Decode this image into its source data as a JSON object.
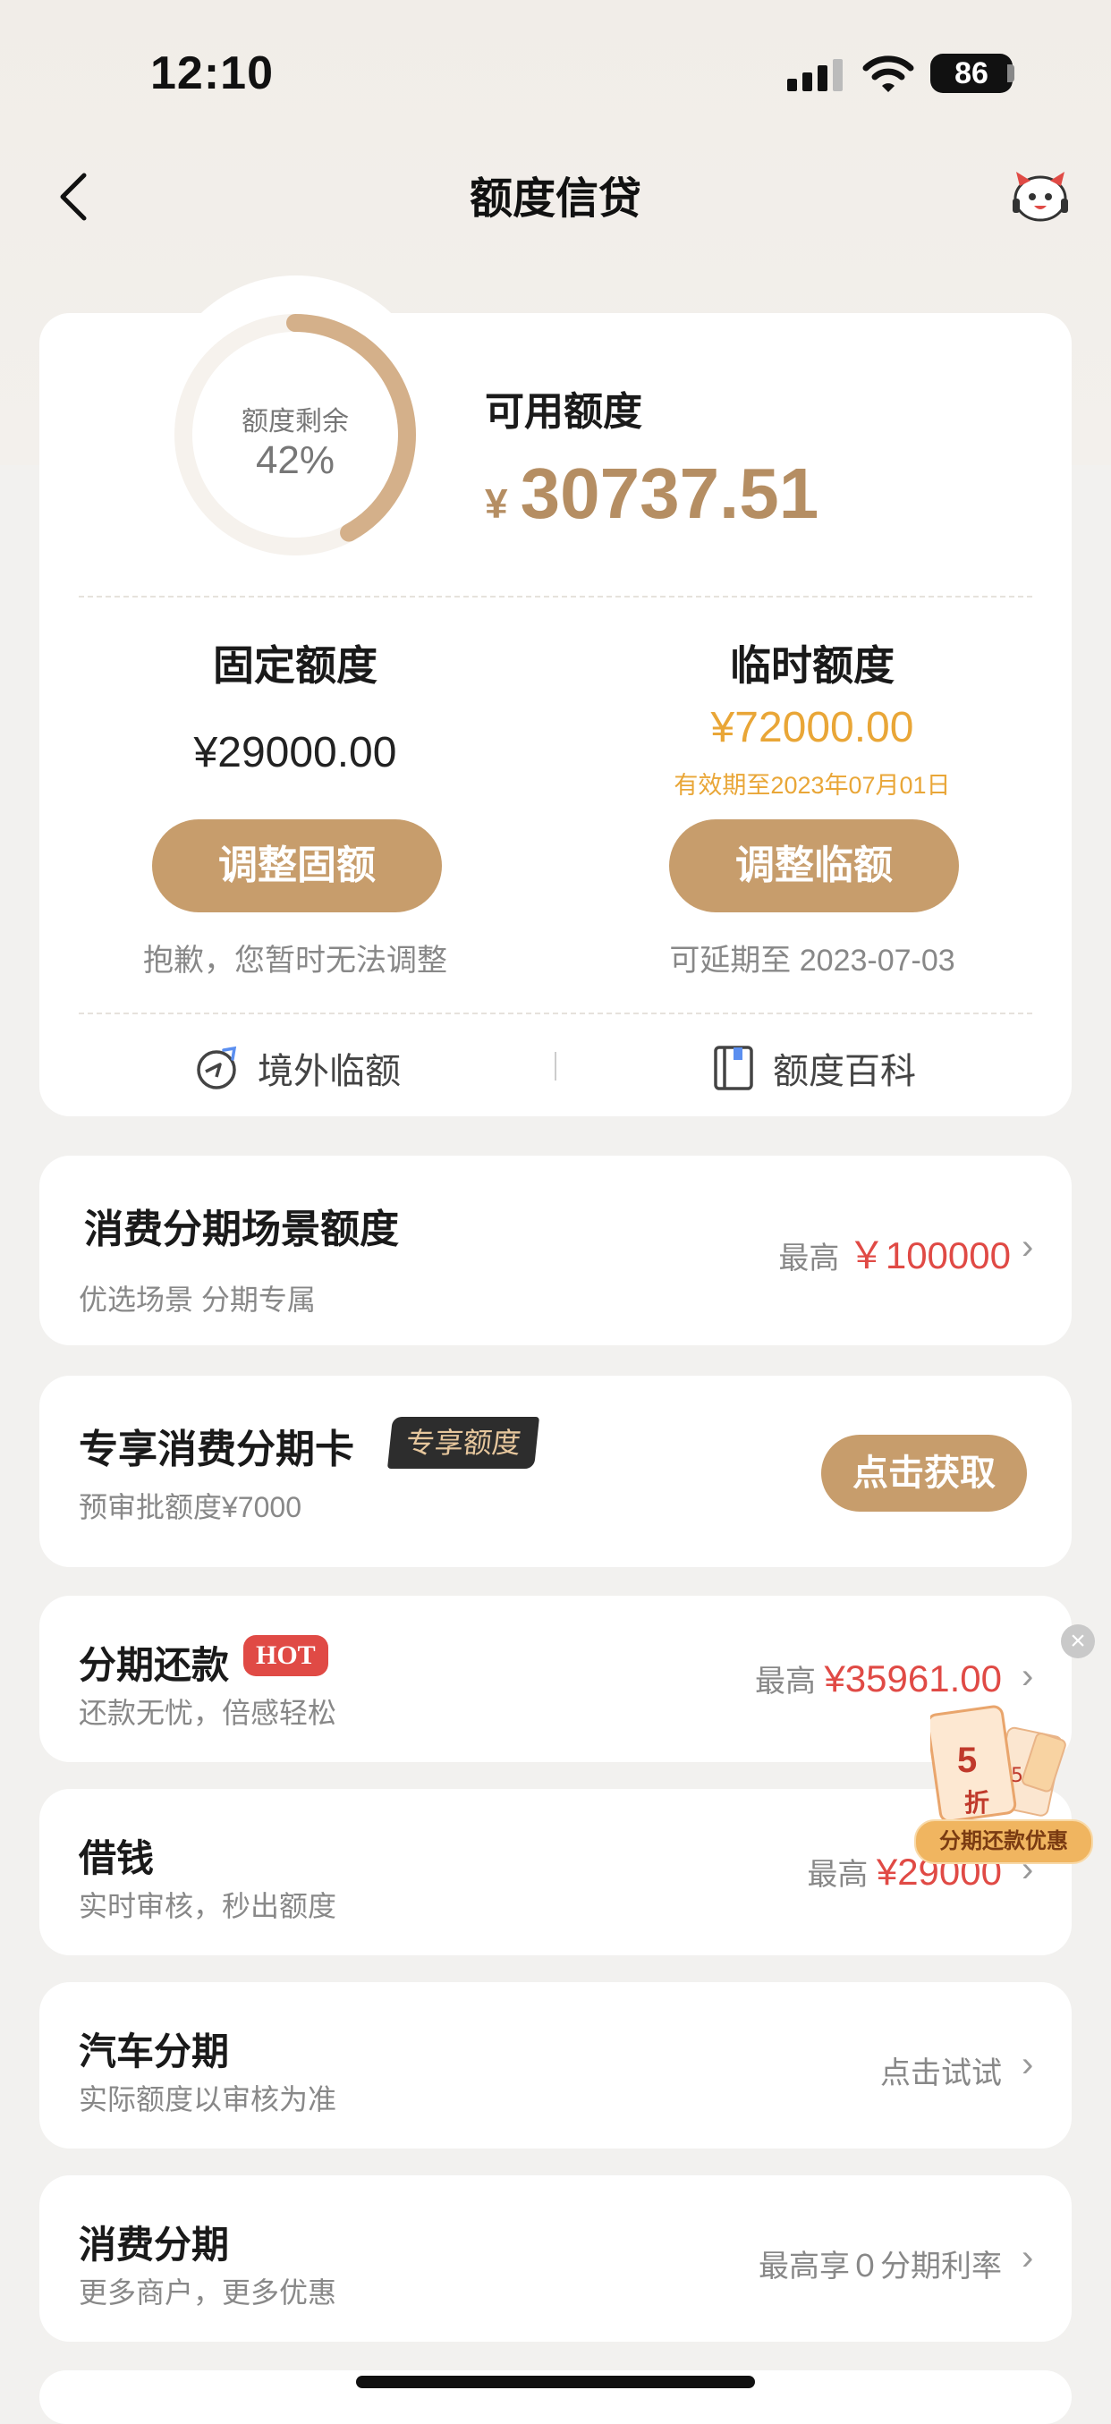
{
  "status_bar": {
    "time": "12:10",
    "battery": "86"
  },
  "nav": {
    "title": "额度信贷"
  },
  "summary": {
    "ring_label": "额度剩余",
    "ring_percent": "42%",
    "ring_fraction": 0.42,
    "available_label": "可用额度",
    "available_currency": "¥",
    "available_value": "30737.51"
  },
  "fixed": {
    "title": "固定额度",
    "value": "¥29000.00",
    "button": "调整固额",
    "note": "抱歉，您暂时无法调整"
  },
  "temp": {
    "title": "临时额度",
    "value": "¥72000.00",
    "expiry": "有效期至2023年07月01日",
    "button": "调整临额",
    "note": "可延期至 2023-07-03"
  },
  "links": {
    "overseas": "境外临额",
    "wiki": "额度百科"
  },
  "scene": {
    "title": "消费分期场景额度",
    "sub": "优选场景 分期专属",
    "prefix": "最高",
    "value": "￥100000"
  },
  "card_offer": {
    "title": "专享消费分期卡",
    "badge": "专享额度",
    "sub": "预审批额度¥7000",
    "button": "点击获取"
  },
  "rows": [
    {
      "title": "分期还款",
      "hot": "HOT",
      "sub": "还款无忧，倍感轻松",
      "prefix": "最高",
      "value": "¥35961.00"
    },
    {
      "title": "借钱",
      "sub": "实时审核，秒出额度",
      "prefix": "最高",
      "value": "¥29000"
    },
    {
      "title": "汽车分期",
      "sub": "实际额度以审核为准",
      "prefix": "点击试试",
      "value": ""
    },
    {
      "title": "消费分期",
      "sub": "更多商户，更多优惠",
      "prefix": "最高享０分期利率",
      "value": ""
    }
  ],
  "promo": {
    "label": "分期还款优惠",
    "discount_num": "5",
    "discount_unit": "折"
  }
}
